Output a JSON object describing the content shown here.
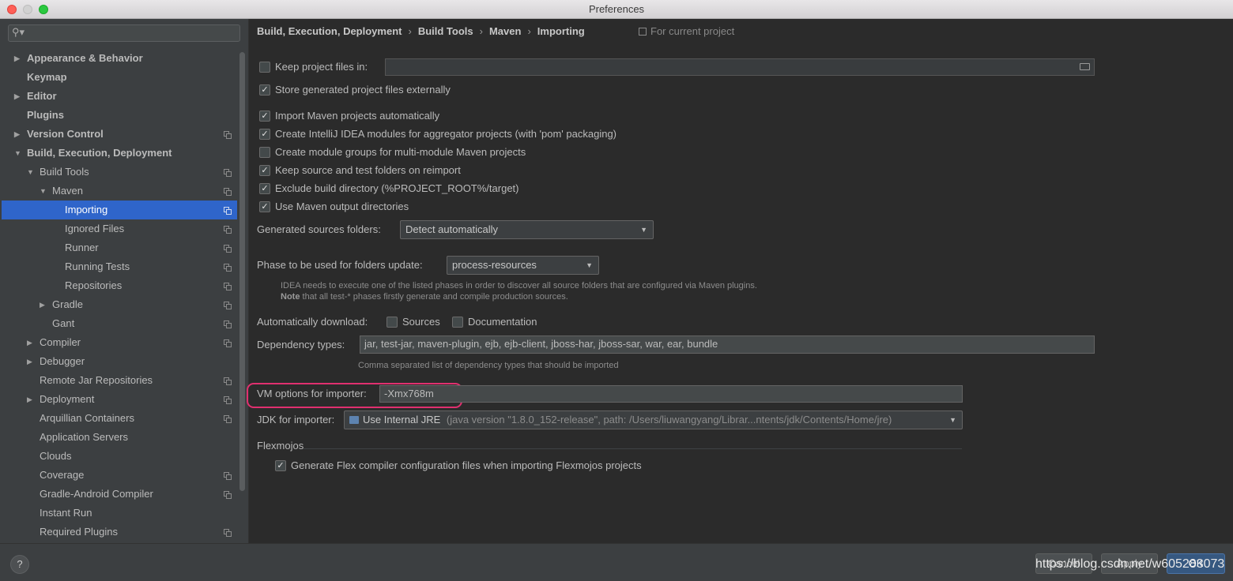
{
  "window": {
    "title": "Preferences"
  },
  "sidebar": {
    "search": {
      "placeholder": ""
    },
    "items": [
      {
        "label": "Appearance & Behavior",
        "bold": true,
        "level": 0,
        "expander": "collapsed",
        "copy_icon": false,
        "selected": false
      },
      {
        "label": "Keymap",
        "bold": true,
        "level": 0,
        "expander": "none",
        "copy_icon": false,
        "selected": false
      },
      {
        "label": "Editor",
        "bold": true,
        "level": 0,
        "expander": "collapsed",
        "copy_icon": false,
        "selected": false
      },
      {
        "label": "Plugins",
        "bold": true,
        "level": 0,
        "expander": "none",
        "copy_icon": false,
        "selected": false
      },
      {
        "label": "Version Control",
        "bold": true,
        "level": 0,
        "expander": "collapsed",
        "copy_icon": true,
        "selected": false
      },
      {
        "label": "Build, Execution, Deployment",
        "bold": true,
        "level": 0,
        "expander": "expanded",
        "copy_icon": false,
        "selected": false
      },
      {
        "label": "Build Tools",
        "bold": false,
        "level": 1,
        "expander": "expanded",
        "copy_icon": true,
        "selected": false
      },
      {
        "label": "Maven",
        "bold": false,
        "level": 2,
        "expander": "expanded",
        "copy_icon": true,
        "selected": false
      },
      {
        "label": "Importing",
        "bold": false,
        "level": 3,
        "expander": "none",
        "copy_icon": true,
        "selected": true
      },
      {
        "label": "Ignored Files",
        "bold": false,
        "level": 3,
        "expander": "none",
        "copy_icon": true,
        "selected": false
      },
      {
        "label": "Runner",
        "bold": false,
        "level": 3,
        "expander": "none",
        "copy_icon": true,
        "selected": false
      },
      {
        "label": "Running Tests",
        "bold": false,
        "level": 3,
        "expander": "none",
        "copy_icon": true,
        "selected": false
      },
      {
        "label": "Repositories",
        "bold": false,
        "level": 3,
        "expander": "none",
        "copy_icon": true,
        "selected": false
      },
      {
        "label": "Gradle",
        "bold": false,
        "level": 2,
        "expander": "collapsed",
        "copy_icon": true,
        "selected": false
      },
      {
        "label": "Gant",
        "bold": false,
        "level": 2,
        "expander": "none",
        "copy_icon": true,
        "selected": false
      },
      {
        "label": "Compiler",
        "bold": false,
        "level": 1,
        "expander": "collapsed",
        "copy_icon": true,
        "selected": false
      },
      {
        "label": "Debugger",
        "bold": false,
        "level": 1,
        "expander": "collapsed",
        "copy_icon": false,
        "selected": false
      },
      {
        "label": "Remote Jar Repositories",
        "bold": false,
        "level": 1,
        "expander": "none",
        "copy_icon": true,
        "selected": false
      },
      {
        "label": "Deployment",
        "bold": false,
        "level": 1,
        "expander": "collapsed",
        "copy_icon": true,
        "selected": false
      },
      {
        "label": "Arquillian Containers",
        "bold": false,
        "level": 1,
        "expander": "none",
        "copy_icon": true,
        "selected": false
      },
      {
        "label": "Application Servers",
        "bold": false,
        "level": 1,
        "expander": "none",
        "copy_icon": false,
        "selected": false
      },
      {
        "label": "Clouds",
        "bold": false,
        "level": 1,
        "expander": "none",
        "copy_icon": false,
        "selected": false
      },
      {
        "label": "Coverage",
        "bold": false,
        "level": 1,
        "expander": "none",
        "copy_icon": true,
        "selected": false
      },
      {
        "label": "Gradle-Android Compiler",
        "bold": false,
        "level": 1,
        "expander": "none",
        "copy_icon": true,
        "selected": false
      },
      {
        "label": "Instant Run",
        "bold": false,
        "level": 1,
        "expander": "none",
        "copy_icon": false,
        "selected": false
      },
      {
        "label": "Required Plugins",
        "bold": false,
        "level": 1,
        "expander": "none",
        "copy_icon": true,
        "selected": false
      }
    ]
  },
  "breadcrumb": [
    "Build, Execution, Deployment",
    "Build Tools",
    "Maven",
    "Importing"
  ],
  "scope_note": "For current project",
  "settings": {
    "keep_project_files": {
      "label": "Keep project files in:",
      "checked": false,
      "value": ""
    },
    "store_generated": {
      "label": "Store generated project files externally",
      "checked": true
    },
    "import_auto": {
      "label": "Import Maven projects automatically",
      "checked": true
    },
    "create_modules": {
      "label": "Create IntelliJ IDEA modules for aggregator projects (with 'pom' packaging)",
      "checked": true
    },
    "create_groups": {
      "label": "Create module groups for multi-module Maven projects",
      "checked": false
    },
    "keep_source": {
      "label": "Keep source and test folders on reimport",
      "checked": true
    },
    "exclude_build": {
      "label": "Exclude build directory (%PROJECT_ROOT%/target)",
      "checked": true
    },
    "use_output": {
      "label": "Use Maven output directories",
      "checked": true
    },
    "generated_sources": {
      "label": "Generated sources folders:",
      "value": "Detect automatically"
    },
    "phase": {
      "label": "Phase to be used for folders update:",
      "value": "process-resources"
    },
    "phase_hint_1": "IDEA needs to execute one of the listed phases in order to discover all source folders that are configured via Maven plugins.",
    "phase_hint_2_bold": "Note",
    "phase_hint_2": " that all test-* phases firstly generate and compile production sources.",
    "auto_download": {
      "label": "Automatically download:",
      "sources": {
        "label": "Sources",
        "checked": false
      },
      "documentation": {
        "label": "Documentation",
        "checked": false
      }
    },
    "dependency_types": {
      "label": "Dependency types:",
      "value": "jar, test-jar, maven-plugin, ejb, ejb-client, jboss-har, jboss-sar, war, ear, bundle",
      "hint": "Comma separated list of dependency types that should be imported"
    },
    "vm_options": {
      "label": "VM options for importer:",
      "value": "-Xmx768m"
    },
    "jdk": {
      "label": "JDK for importer:",
      "value": "Use Internal JRE",
      "detail": "(java version \"1.8.0_152-release\", path: /Users/liuwangyang/Librar...ntents/jdk/Contents/Home/jre)"
    },
    "flexmojos": {
      "section": "Flexmojos",
      "generate": {
        "label": "Generate Flex compiler configuration files when importing Flexmojos projects",
        "checked": true
      }
    }
  },
  "footer": {
    "help": "?",
    "cancel": "Cancel",
    "apply": "Apply",
    "ok": "OK",
    "watermark": "https://blog.csdn.net/w605283073"
  },
  "colors": {
    "selection": "#2f65ca",
    "highlight_border": "#e0306f",
    "ok_button": "#365880"
  }
}
